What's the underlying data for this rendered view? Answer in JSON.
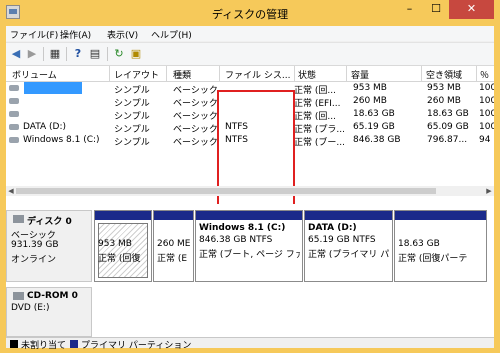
{
  "window": {
    "title": "ディスクの管理",
    "min": "–",
    "max": "☐",
    "close": "✕"
  },
  "menu": [
    "ファイル(F)",
    "操作(A)",
    "表示(V)",
    "ヘルプ(H)"
  ],
  "toolbar": {
    "icons": [
      "back-icon",
      "forward-icon",
      "properties-icon",
      "help-icon",
      "rescan-icon",
      "settings-icon"
    ]
  },
  "volume_table": {
    "headers": [
      "ボリューム",
      "レイアウト",
      "種類",
      "ファイル シス...",
      "状態",
      "容量",
      "空き領域",
      "％"
    ],
    "rows": [
      {
        "volume": "",
        "layout": "シンプル",
        "type": "ベーシック",
        "fs": "",
        "status": "正常 (回...",
        "capacity": "953 MB",
        "free": "953 MB",
        "pct": "100"
      },
      {
        "volume": "",
        "layout": "シンプル",
        "type": "ベーシック",
        "fs": "",
        "status": "正常 (EFI...",
        "capacity": "260 MB",
        "free": "260 MB",
        "pct": "100"
      },
      {
        "volume": "",
        "layout": "シンプル",
        "type": "ベーシック",
        "fs": "",
        "status": "正常 (回...",
        "capacity": "18.63 GB",
        "free": "18.63 GB",
        "pct": "100"
      },
      {
        "volume": "DATA (D:)",
        "layout": "シンプル",
        "type": "ベーシック",
        "fs": "NTFS",
        "status": "正常 (プラ...",
        "capacity": "65.19 GB",
        "free": "65.09 GB",
        "pct": "100"
      },
      {
        "volume": "Windows 8.1 (C:)",
        "layout": "シンプル",
        "type": "ベーシック",
        "fs": "NTFS",
        "status": "正常 (ブー...",
        "capacity": "846.38 GB",
        "free": "796.87...",
        "pct": "94"
      }
    ]
  },
  "disk0": {
    "title": "ディスク 0",
    "lines": [
      "ベーシック",
      "931.39 GB",
      "オンライン"
    ],
    "partitions": [
      {
        "name": "",
        "size": "953 MB",
        "status": "正常 (回復"
      },
      {
        "name": "",
        "size": "260 ME",
        "status": "正常 (E"
      },
      {
        "name": "Windows 8.1  (C:)",
        "size": "846.38 GB NTFS",
        "status": "正常 (ブート, ページ ファイ"
      },
      {
        "name": "DATA  (D:)",
        "size": "65.19 GB NTFS",
        "status": "正常 (プライマリ パ"
      },
      {
        "name": "",
        "size": "18.63 GB",
        "status": "正常 (回復パーテ"
      }
    ]
  },
  "cdrom0": {
    "title": "CD-ROM 0",
    "line": "DVD (E:)"
  },
  "legend": [
    {
      "label": "未割り当て",
      "color": "#000000"
    },
    {
      "label": "プライマリ パーティション",
      "color": "#1a2a8a"
    }
  ]
}
